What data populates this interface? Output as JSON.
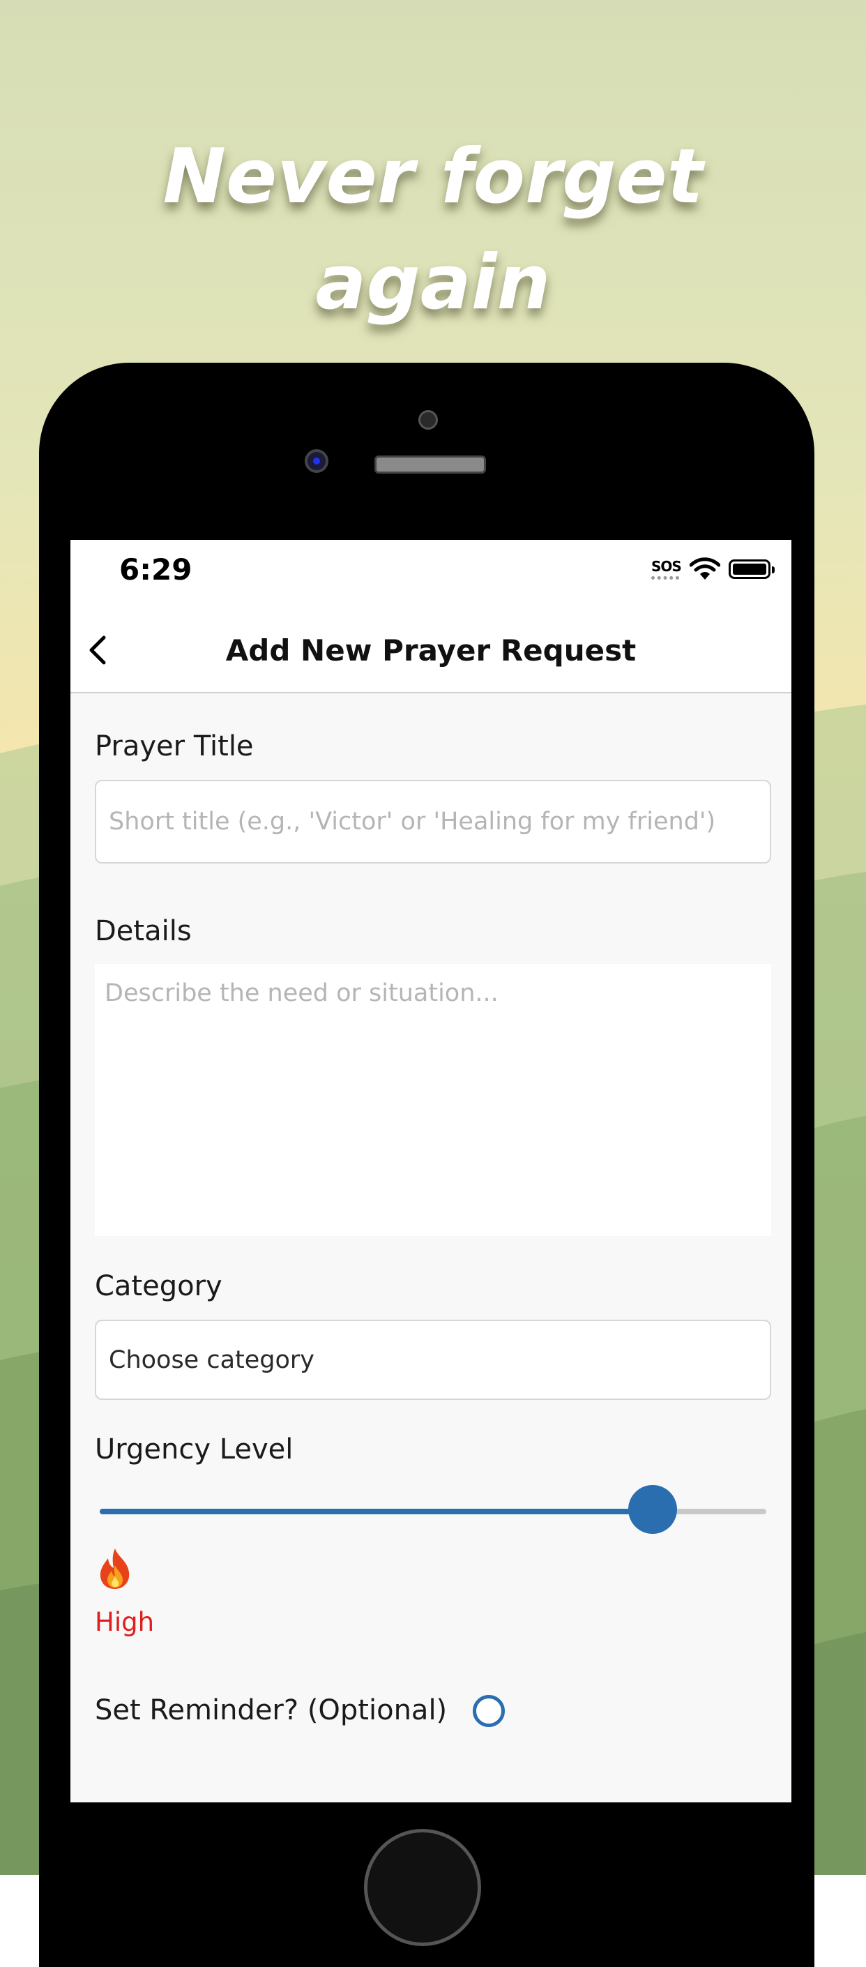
{
  "headline": {
    "line1": "Never forget",
    "line2": "again"
  },
  "status_bar": {
    "time": "6:29",
    "sos": "SOS"
  },
  "nav": {
    "title": "Add New Prayer Request"
  },
  "form": {
    "title_label": "Prayer Title",
    "title_placeholder": "Short title (e.g., 'Victor' or 'Healing for my friend')",
    "details_label": "Details",
    "details_placeholder": "Describe the need or situation...",
    "category_label": "Category",
    "category_value": "Choose category",
    "urgency_label": "Urgency Level",
    "urgency_level": 0.83,
    "urgency_text": "High",
    "reminder_label": "Set Reminder? (Optional)",
    "reminder_checked": false
  },
  "colors": {
    "accent": "#2a6eb0",
    "urgency_high": "#e01e1e"
  },
  "icons": {
    "back": "chevron-left-icon",
    "urgency": "flame-icon",
    "wifi": "wifi-icon",
    "battery": "battery-icon"
  }
}
